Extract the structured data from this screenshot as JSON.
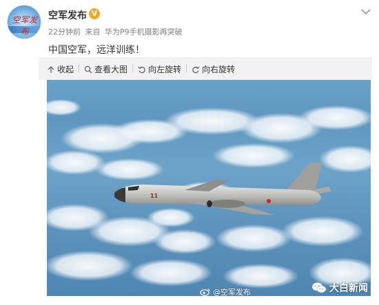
{
  "account": {
    "name": "空军发布",
    "avatar_text": "空军发布",
    "verified_badge": "V"
  },
  "meta": {
    "time": "22分钟前",
    "source_prefix": "来自",
    "source": "华为P9手机摄影再突破"
  },
  "post": {
    "text": "中国空军，远洋训练！"
  },
  "toolbar": {
    "collapse_label": "收起",
    "view_large_label": "查看大图",
    "rotate_left_label": "向左旋转",
    "rotate_right_label": "向右旋转"
  },
  "photo": {
    "aircraft_marking": "11"
  },
  "watermarks": {
    "weibo": "@空军发布",
    "wechat": "大白新闻"
  },
  "colors": {
    "verified": "#f5a623",
    "toolbar_bg": "#f2f2f5",
    "sky": "#5f97c0"
  }
}
